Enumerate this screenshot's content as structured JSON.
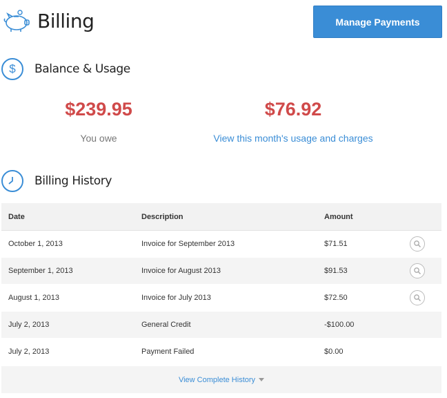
{
  "header": {
    "title": "Billing",
    "manage_button": "Manage Payments"
  },
  "balance": {
    "section_title": "Balance & Usage",
    "owe_amount": "$239.95",
    "owe_label": "You owe",
    "usage_amount": "$76.92",
    "usage_link": "View this month's usage and charges"
  },
  "history": {
    "section_title": "Billing History",
    "columns": [
      "Date",
      "Description",
      "Amount"
    ],
    "rows": [
      {
        "date": "October 1, 2013",
        "description": "Invoice for September 2013",
        "amount": "$71.51",
        "view": true
      },
      {
        "date": "September 1, 2013",
        "description": "Invoice for August 2013",
        "amount": "$91.53",
        "view": true
      },
      {
        "date": "August 1, 2013",
        "description": "Invoice for July 2013",
        "amount": "$72.50",
        "view": true
      },
      {
        "date": "July 2, 2013",
        "description": "General Credit",
        "amount": "-$100.00",
        "view": false
      },
      {
        "date": "July 2, 2013",
        "description": "Payment Failed",
        "amount": "$0.00",
        "view": false
      }
    ],
    "view_all": "View Complete History"
  },
  "colors": {
    "accent": "#3a8dd6",
    "amount_red": "#d04a4a"
  },
  "icons": {
    "header": "piggy-bank-icon",
    "balance": "dollar-icon",
    "history": "clock-icon",
    "row_action": "magnifier-icon"
  }
}
